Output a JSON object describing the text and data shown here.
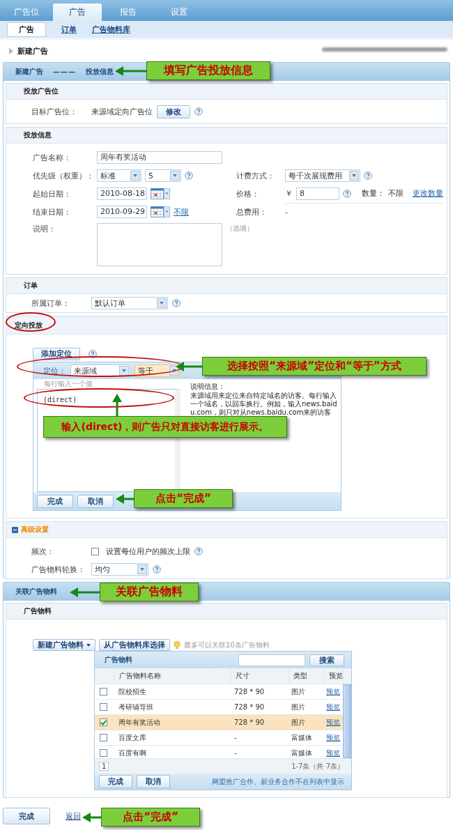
{
  "top_tabs": [
    {
      "label": "广告位",
      "selected": false
    },
    {
      "label": "广告",
      "selected": true
    },
    {
      "label": "报告",
      "selected": false
    },
    {
      "label": "设置",
      "selected": false
    }
  ],
  "sub_tabs": [
    {
      "label": "广告",
      "selected": true
    },
    {
      "label": "订单",
      "selected": false
    },
    {
      "label": "广告物料库",
      "selected": false
    }
  ],
  "page_title": "新建广告",
  "steps": {
    "step_1": "新建广告",
    "separator": "———",
    "step_2": "投放信息"
  },
  "placement": {
    "heading": "投放广告位",
    "label": "目标广告位：",
    "value": "来源域定向广告位",
    "button": "修改"
  },
  "delivery": {
    "heading": "投放信息",
    "name_label": "广告名称：",
    "name_value": "周年有奖活动",
    "priority_label": "优先级（权重）：",
    "priority_level": "标准",
    "priority_weight": "5",
    "billing_label": "计费方式：",
    "billing_value": "每千次展现费用",
    "start_label": "起始日期：",
    "start_value": "2010-08-18",
    "price_label": "价格：",
    "currency": "￥",
    "price_value": "8",
    "quantity_label": "数量：",
    "quantity_value": "不限",
    "quantity_link": "更改数量",
    "end_label": "结束日期：",
    "end_value": "2010-09-29",
    "unlimited_link": "不限",
    "total_label": "总费用：",
    "total_value": "-",
    "note_label": "说明：",
    "note_hint": "（选填）"
  },
  "order": {
    "heading": "订单",
    "label": "所属订单：",
    "value": "默认订单"
  },
  "targeting": {
    "heading": "定向投放",
    "add_button": "添加定位",
    "type_label": "定位：",
    "type_value": "来源域",
    "operator_value": "等于",
    "input_hint": "每行输入一个值",
    "input_value": "(direct)",
    "help_title": "说明信息：",
    "help_text": "来源域用来定位来自特定域名的访客。每行输入一个域名，以回车换行。例如，输入news.baidu.com，则只对从news.baidu.com来的访客",
    "done_button": "完成",
    "cancel_button": "取消"
  },
  "advanced": {
    "heading": "高级设置",
    "expanded": true,
    "frequency_label": "频次：",
    "frequency_option": "设置每位用户的频次上限",
    "frequency_checked": false,
    "rotation_label": "广告物料轮换：",
    "rotation_value": "均匀"
  },
  "materials": {
    "panel_title": "关联广告物料",
    "heading": "广告物料",
    "new_button": "新建广告物料",
    "library_button": "从广告物料库选择",
    "tip": "最多可以关联10条广告物料",
    "table": {
      "title": "广告物料",
      "search_button": "搜索",
      "columns": [
        "广告物料名称",
        "尺寸",
        "类型",
        "预览"
      ],
      "rows": [
        {
          "name": "院校招生",
          "size": "728 * 90",
          "type": "图片",
          "preview": "预览",
          "selected": false
        },
        {
          "name": "考研辅导班",
          "size": "728 * 90",
          "type": "图片",
          "preview": "预览",
          "selected": false
        },
        {
          "name": "周年有奖活动",
          "size": "728 * 90",
          "type": "图片",
          "preview": "预览",
          "selected": true
        },
        {
          "name": "百度文库",
          "size": "-",
          "type": "富媒体",
          "preview": "预览",
          "selected": false
        },
        {
          "name": "百度有啊",
          "size": "-",
          "type": "富媒体",
          "preview": "预览",
          "selected": false
        }
      ],
      "page": "1",
      "count": "1-7条（共 7条）",
      "done_button": "完成",
      "cancel_button": "取消",
      "note": "网盟推广合作、新业务合作不在列表中显示"
    }
  },
  "footer": {
    "done_button": "完成",
    "back_link": "返回"
  },
  "callouts": [
    {
      "text": "填写广告投放信息"
    },
    {
      "text": "选择按照“来源域”定位和“等于”方式"
    },
    {
      "text": "输入(direct)，则广告只对直接访客进行展示。"
    },
    {
      "text": "点击“完成”"
    },
    {
      "text": "关联广告物料"
    },
    {
      "text": "点击“完成”"
    }
  ]
}
